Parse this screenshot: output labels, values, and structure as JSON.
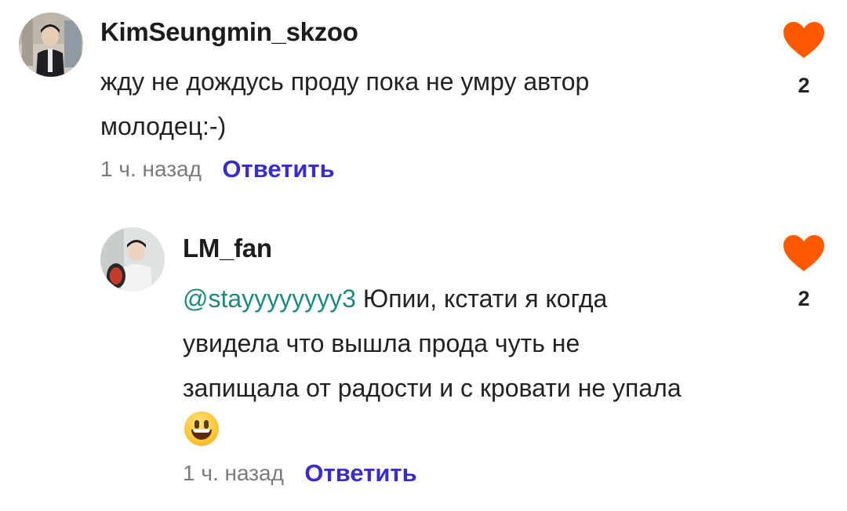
{
  "accent_color": "#3a2cc6",
  "like_color": "#ff5a00",
  "mention_color": "#1e8a7e",
  "comments": [
    {
      "username": "KimSeungmin_skzoo",
      "text": "жду не дождусь проду пока не умру автор молодец:-)",
      "time": "1 ч. назад",
      "reply_label": "Ответить",
      "likes": "2",
      "like_icon": "heart-icon"
    },
    {
      "username": "LM_fan",
      "mention": "@stayyyyyyyy3",
      "text": " Юпии, кстати я когда увидела что вышла прода чуть не запищала от радости и с кровати не упала",
      "emoji": "grinning-face",
      "time": "1 ч. назад",
      "reply_label": "Ответить",
      "likes": "2",
      "like_icon": "heart-icon"
    }
  ]
}
